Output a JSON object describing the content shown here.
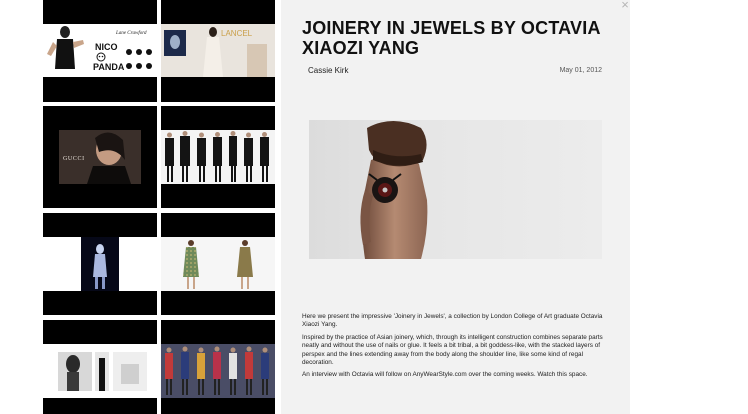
{
  "gallery": {
    "tiles": [
      {
        "name": "nico-panda-tile",
        "alt": "Lane Crawford Nico Panda"
      },
      {
        "name": "lancel-tile",
        "alt": "Lancel"
      },
      {
        "name": "gucci-tile",
        "alt": "Gucci"
      },
      {
        "name": "runway-black-tile",
        "alt": "Runway models in black"
      },
      {
        "name": "figure-dark-tile",
        "alt": "Figure on dark background"
      },
      {
        "name": "dresses-tile",
        "alt": "Printed dresses"
      },
      {
        "name": "bw-editorial-tile",
        "alt": "Black and white editorial"
      },
      {
        "name": "runway-print-tile",
        "alt": "Runway printed looks"
      }
    ],
    "nico_panda": {
      "brand": "Lane Crawford",
      "line1": "NICO",
      "line2": "PANDA"
    },
    "gucci_text": "GUCCI",
    "lancel_text": "LANCEL"
  },
  "article": {
    "title": "JOINERY IN JEWELS BY OCTAVIA XIAOZI YANG",
    "author": "Cassie Kirk",
    "date": "May 01, 2012",
    "paragraphs": [
      "Here we present the impressive 'Joinery in Jewels', a collection by London College of Art graduate Octavia Xiaozi Yang.",
      "Inspired by the practice of Asian joinery, which, through its intelligent construction combines separate parts neatly and without the use of nails or glue. It feels a bit tribal, a bit goddess-like, with the stacked layers of perspex and the lines extending away from the body along the shoulder line, like some kind of regal decoration.",
      "An interview with Octavia will follow on AnyWearStyle.com over the coming weeks. Watch this space."
    ]
  },
  "close_symbol": "×",
  "colors": {
    "panel_bg": "#f2f2f2",
    "tile_bg": "#000000",
    "title": "#111111"
  }
}
